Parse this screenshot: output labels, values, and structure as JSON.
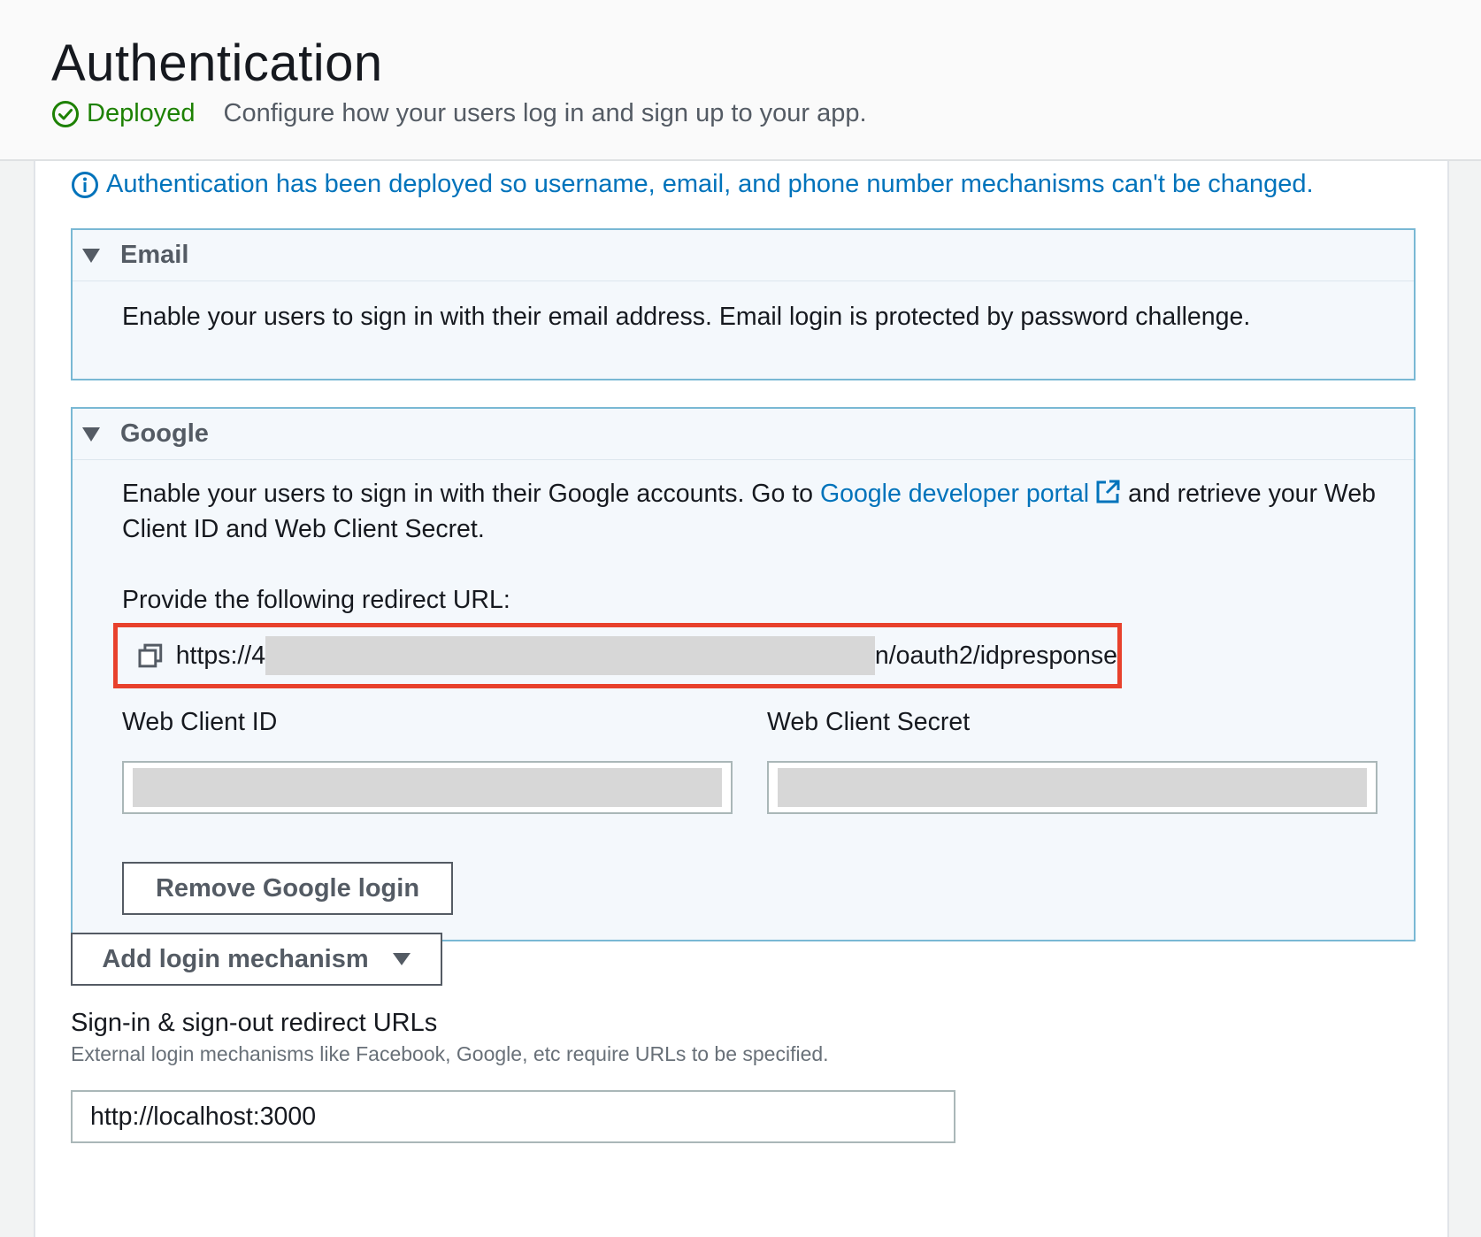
{
  "header": {
    "title": "Authentication",
    "status": "Deployed",
    "description": "Configure how your users log in and sign up to your app."
  },
  "notice": "Authentication has been deployed so username, email, and phone number mechanisms can't be changed.",
  "email_panel": {
    "title": "Email",
    "text": "Enable your users to sign in with their email address. Email login is protected by password challenge."
  },
  "google_panel": {
    "title": "Google",
    "text_before": "Enable your users to sign in with their Google accounts. Go to ",
    "link": "Google developer portal",
    "text_after": "and retrieve your Web Client ID and Web Client Secret.",
    "redirect_label": "Provide the following redirect URL:",
    "redirect_url_start": "https://4",
    "redirect_url_end": "n/oauth2/idpresponse",
    "client_id_label": "Web Client ID",
    "client_secret_label": "Web Client Secret",
    "remove_button": "Remove Google login"
  },
  "add_button": "Add login mechanism",
  "redirect_section": {
    "title": "Sign-in & sign-out redirect URLs",
    "description": "External login mechanisms like Facebook, Google, etc require URLs to be specified.",
    "url_value": "http://localhost:3000"
  },
  "colors": {
    "status": "#1d8102",
    "link": "#0073bb",
    "highlight": "#e8412c",
    "panel_border": "#79b8d4"
  }
}
